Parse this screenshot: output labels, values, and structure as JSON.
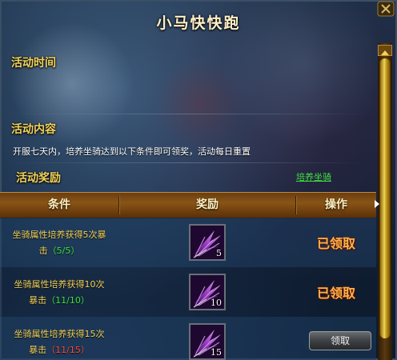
{
  "window": {
    "title": "小马快快跑"
  },
  "sections": {
    "time_label": "活动时间",
    "content_label": "活动内容",
    "content_text": "开服七天内，培养坐骑达到以下条件即可领奖，活动每日重置",
    "reward_label": "活动奖励",
    "reward_link": "培养坐骑"
  },
  "table": {
    "headers": [
      "条件",
      "奖励",
      "操作"
    ],
    "rows": [
      {
        "cond_line1": "坐骑属性培养获得5次暴",
        "cond_line2": "击",
        "progress": "（5/5）",
        "progress_status": "complete",
        "reward_count": "5",
        "action": "已领取",
        "action_type": "claimed"
      },
      {
        "cond_line1": "坐骑属性培养获得10次",
        "cond_line2": "暴击",
        "progress": "（11/10）",
        "progress_status": "complete",
        "reward_count": "10",
        "action": "已领取",
        "action_type": "claimed"
      },
      {
        "cond_line1": "坐骑属性培养获得15次",
        "cond_line2": "暴击",
        "progress": "（11/15）",
        "progress_status": "incomplete",
        "reward_count": "15",
        "action": "领取",
        "action_type": "button"
      }
    ]
  },
  "colors": {
    "gold_text": "#f2d35a",
    "progress_complete": "#3fe23f",
    "progress_incomplete": "#ff4a3a",
    "claimed": "#ffb34a"
  },
  "icons": {
    "close": "close-icon",
    "reward_item": "mount-feather-icon",
    "scroll_up": "scroll-up-arrow-icon"
  }
}
